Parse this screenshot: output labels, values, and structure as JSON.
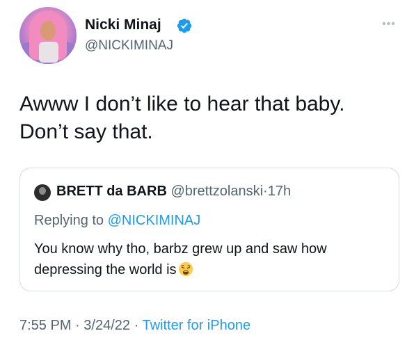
{
  "author": {
    "display_name": "Nicki Minaj",
    "handle": "@NICKIMINAJ",
    "verified": true
  },
  "tweet": {
    "line1": "Awww I don’t like to hear that baby.",
    "line2": "Don’t say that."
  },
  "quoted": {
    "display_name": "BRETT da BARB",
    "handle": "@brettzolanski",
    "separator": "·",
    "age": "17h",
    "replying_prefix": "Replying to",
    "replying_to": "@NICKIMINAJ",
    "line1": "You know why tho, barbz grew up and saw how",
    "line2": "depressing the world is",
    "emoji": "weary-face-emoji"
  },
  "footer": {
    "time": "7:55 PM",
    "sep1": "·",
    "date": "3/24/22",
    "sep2": "·",
    "source": "Twitter for iPhone"
  },
  "colors": {
    "text": "#0f1419",
    "muted": "#536471",
    "link": "#1d9bf0",
    "border": "#d6dde2"
  },
  "icons": {
    "verified": "verified-badge-icon",
    "more": "more-options-icon"
  }
}
